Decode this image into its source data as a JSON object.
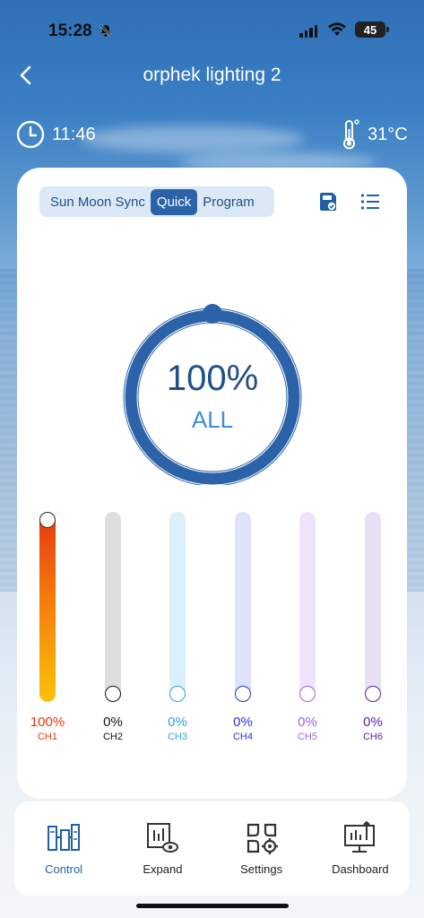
{
  "status_bar": {
    "time": "15:28",
    "battery": "45"
  },
  "header": {
    "title": "orphek lighting 2"
  },
  "info": {
    "clock_time": "11:46",
    "temperature": "31°C"
  },
  "modes": {
    "tabs": [
      "Sun Moon Sync",
      "Quick",
      "Program"
    ],
    "active": "Quick"
  },
  "dial": {
    "value": "100%",
    "label": "ALL",
    "level": 1.0
  },
  "channels": [
    {
      "pct": "100%",
      "name": "CH1",
      "level": 1.0,
      "color": "#e8350f"
    },
    {
      "pct": "0%",
      "name": "CH2",
      "level": 0.0,
      "color": "#111111"
    },
    {
      "pct": "0%",
      "name": "CH3",
      "level": 0.0,
      "color": "#2aa6e0"
    },
    {
      "pct": "0%",
      "name": "CH4",
      "level": 0.0,
      "color": "#2a35d8"
    },
    {
      "pct": "0%",
      "name": "CH5",
      "level": 0.0,
      "color": "#a060f0"
    },
    {
      "pct": "0%",
      "name": "CH6",
      "level": 0.0,
      "color": "#5a1fa8"
    }
  ],
  "nav": {
    "items": [
      "Control",
      "Expand",
      "Settings",
      "Dashboard"
    ],
    "active": "Control"
  },
  "colors": {
    "primary": "#2c63a8",
    "accent": "#3a8fd6"
  }
}
